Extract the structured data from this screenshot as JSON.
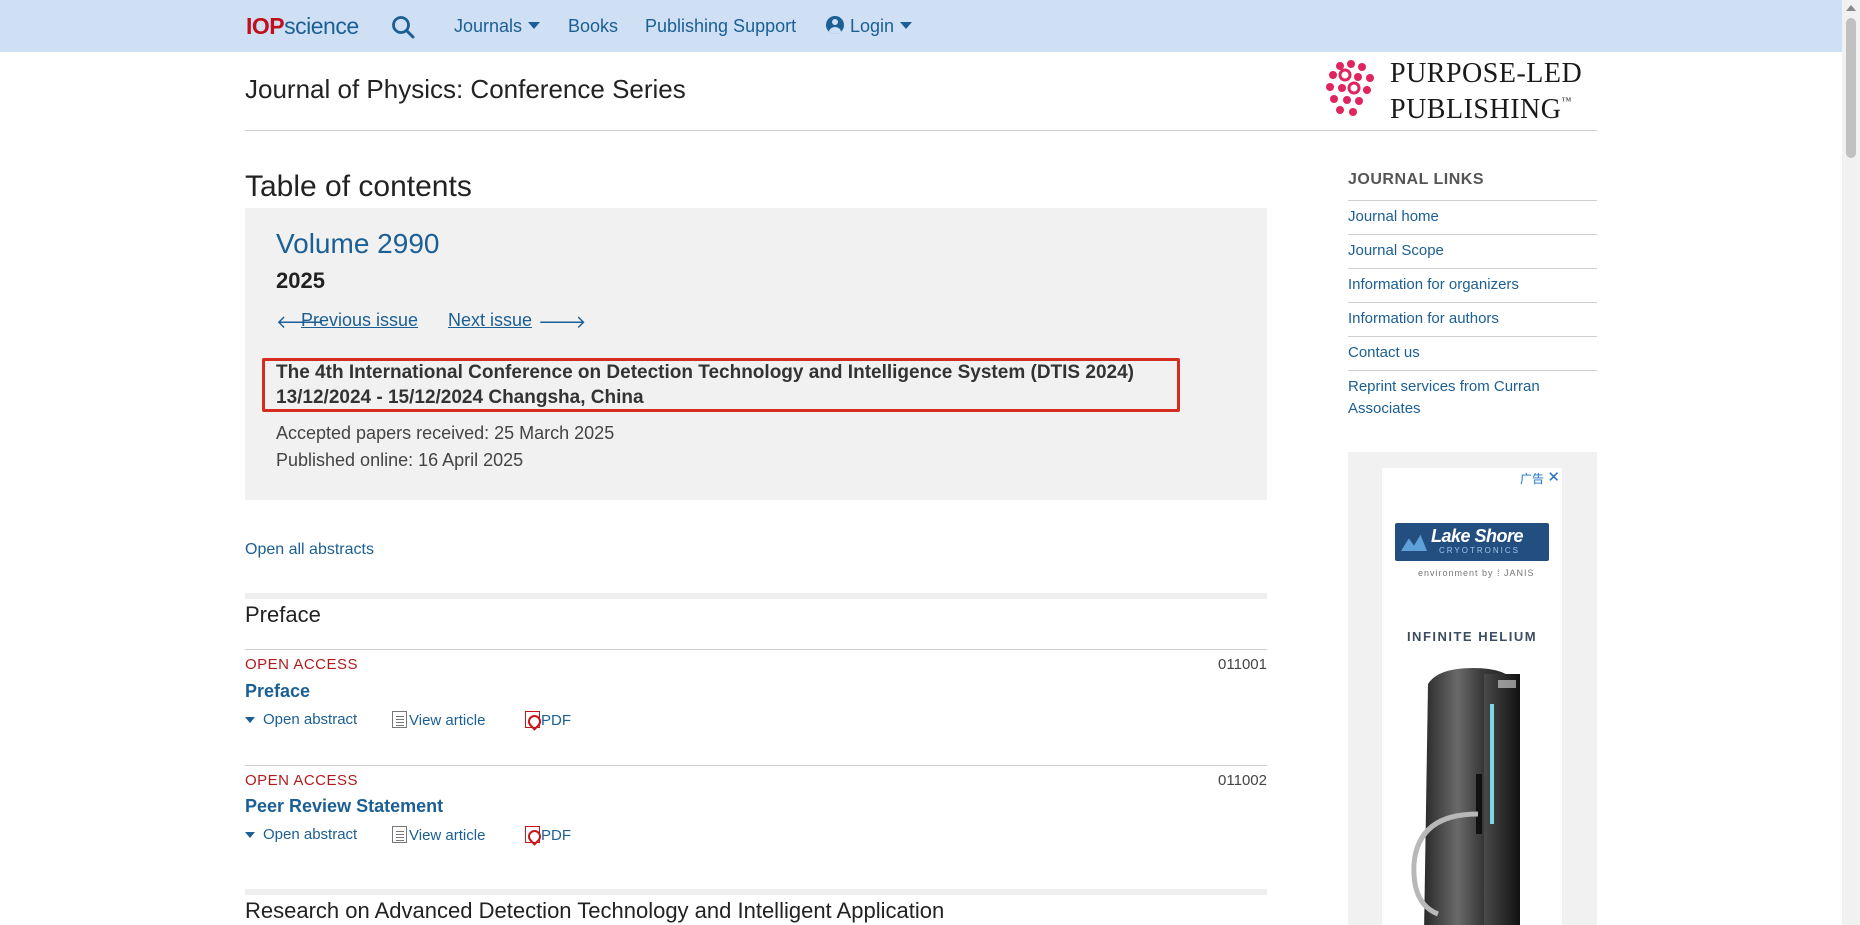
{
  "nav": {
    "logo_iop": "IOP",
    "logo_science": "science",
    "search_icon": "search-icon",
    "journals": "Journals",
    "books": "Books",
    "publishing_support": "Publishing Support",
    "login": "Login"
  },
  "header": {
    "journal_title": "Journal of Physics: Conference Series",
    "ppl_line1": "PURPOSE-LED",
    "ppl_line2": "PUBLISHING",
    "ppl_tm": "™"
  },
  "toc": {
    "heading": "Table of contents",
    "volume": "Volume 2990",
    "year": "2025",
    "previous_issue": "Previous issue",
    "next_issue": "Next issue",
    "conference_line1": "The 4th International Conference on Detection Technology and Intelligence System (DTIS 2024)",
    "conference_line2": "13/12/2024 - 15/12/2024 Changsha, China",
    "accepted": "Accepted papers received: 25 March 2025",
    "published": "Published online: 16 April 2025",
    "open_all": "Open all abstracts"
  },
  "sections": [
    {
      "title": "Preface",
      "articles": [
        {
          "access": "OPEN ACCESS",
          "number": "011001",
          "title": "Preface",
          "open_abstract": "Open abstract",
          "view_article": "View article",
          "pdf": "PDF"
        },
        {
          "access": "OPEN ACCESS",
          "number": "011002",
          "title": "Peer Review Statement",
          "open_abstract": "Open abstract",
          "view_article": "View article",
          "pdf": "PDF"
        }
      ]
    },
    {
      "title": "Research on Advanced Detection Technology and Intelligent Application"
    }
  ],
  "sidebar": {
    "heading": "JOURNAL LINKS",
    "links": [
      "Journal home",
      "Journal Scope",
      "Information for organizers",
      "Information for authors",
      "Contact us",
      "Reprint services from Curran Associates"
    ]
  },
  "ad": {
    "label": "广告",
    "close": "✕",
    "brand": "Lake Shore",
    "brand_sub": "CRYOTRONICS",
    "env": "environment by  ⁞ JANIS",
    "headline": "INFINITE HELIUM"
  },
  "colors": {
    "nav_bg": "#cfe0f4",
    "link": "#1b5f94",
    "open_access": "#b01c1c",
    "highlight_border": "#d62b1f",
    "ppl_pink": "#e0245e"
  }
}
